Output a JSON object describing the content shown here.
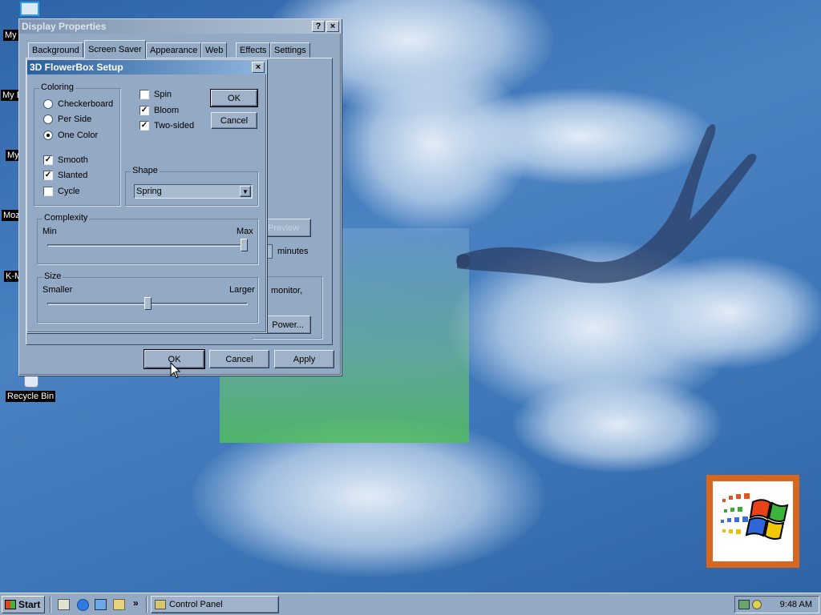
{
  "desktop": {
    "icons": [
      {
        "label": "My",
        "name": "my-documents"
      },
      {
        "label": "My D",
        "name": "my-computer"
      },
      {
        "label": "My",
        "name": "my-network-places"
      },
      {
        "label": "Moz",
        "name": "mozilla"
      },
      {
        "label": "K-M",
        "name": "k-meleon"
      },
      {
        "label": "Recycle Bin",
        "name": "recycle-bin"
      }
    ]
  },
  "display_properties": {
    "title": "Display Properties",
    "help_symbol": "?",
    "close_symbol": "×",
    "tabs": [
      "Background",
      "Screen Saver",
      "Appearance",
      "Web",
      "Effects",
      "Settings"
    ],
    "active_tab": "Screen Saver",
    "preview_label": "Preview",
    "minutes_label": "minutes",
    "monitor_text": "monitor,",
    "power_label": "Power...",
    "ok_label": "OK",
    "cancel_label": "Cancel",
    "apply_label": "Apply"
  },
  "flowerbox": {
    "title": "3D FlowerBox Setup",
    "close_symbol": "×",
    "coloring": {
      "label": "Coloring",
      "options": [
        {
          "label": "Checkerboard",
          "selected": false
        },
        {
          "label": "Per Side",
          "selected": false
        },
        {
          "label": "One Color",
          "selected": true
        }
      ],
      "checks": [
        {
          "label": "Smooth",
          "checked": true
        },
        {
          "label": "Slanted",
          "checked": true
        },
        {
          "label": "Cycle",
          "checked": false
        }
      ]
    },
    "right_checks": [
      {
        "label": "Spin",
        "checked": false
      },
      {
        "label": "Bloom",
        "checked": true
      },
      {
        "label": "Two-sided",
        "checked": true
      }
    ],
    "ok_label": "OK",
    "cancel_label": "Cancel",
    "shape": {
      "label": "Shape",
      "value": "Spring"
    },
    "complexity": {
      "label": "Complexity",
      "min_label": "Min",
      "max_label": "Max",
      "value": 1.0
    },
    "size": {
      "label": "Size",
      "min_label": "Smaller",
      "max_label": "Larger",
      "value": 0.5
    },
    "check_mark": "✓"
  },
  "taskbar": {
    "start_label": "Start",
    "quick_launch_more": "»",
    "task_label": "Control Panel",
    "clock": "9:48 AM"
  },
  "colors": {
    "accent": "#2a5f9e",
    "window_face": "#94a9c4",
    "desktop": "#3f78b8"
  }
}
